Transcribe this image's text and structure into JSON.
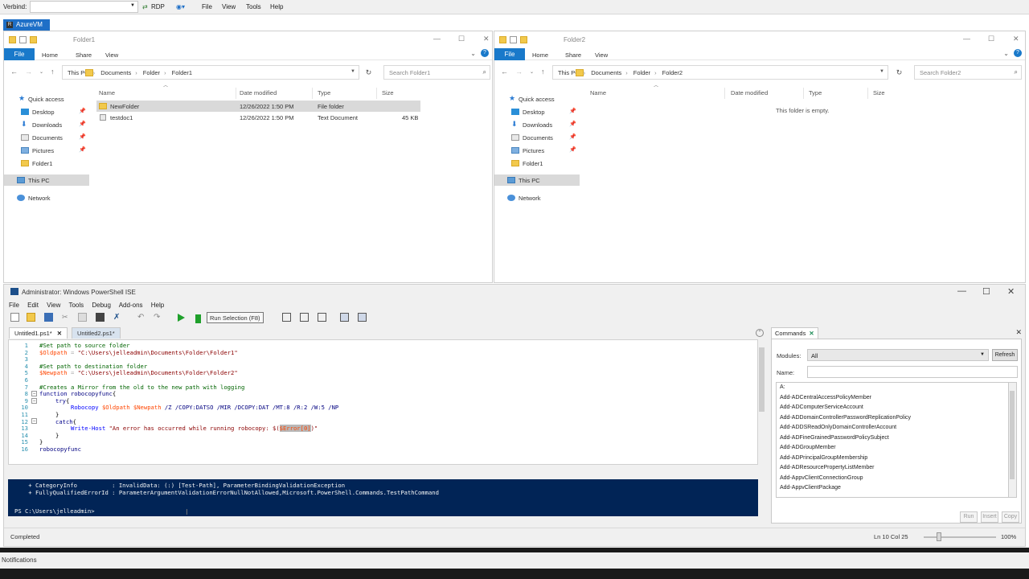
{
  "rdp": {
    "verbind_label": "Verbind:",
    "rdp_label": "RDP",
    "menu": [
      "File",
      "View",
      "Tools",
      "Help"
    ]
  },
  "vm": {
    "tab_label": "AzureVM",
    "tab_icon": "R"
  },
  "explorer1": {
    "title": "Folder1",
    "ribbon": {
      "file": "File",
      "home": "Home",
      "share": "Share",
      "view": "View"
    },
    "path": [
      "This PC",
      "Documents",
      "Folder",
      "Folder1"
    ],
    "search_placeholder": "Search Folder1",
    "nav": {
      "quick_access": "Quick access",
      "items": [
        "Desktop",
        "Downloads",
        "Documents",
        "Pictures",
        "Folder1"
      ],
      "this_pc": "This PC",
      "network": "Network"
    },
    "columns": [
      "Name",
      "Date modified",
      "Type",
      "Size"
    ],
    "files": [
      {
        "name": "NewFolder",
        "date": "12/26/2022 1:50 PM",
        "type": "File folder",
        "size": ""
      },
      {
        "name": "testdoc1",
        "date": "12/26/2022 1:50 PM",
        "type": "Text Document",
        "size": "45 KB"
      }
    ]
  },
  "explorer2": {
    "title": "Folder2",
    "ribbon": {
      "file": "File",
      "home": "Home",
      "share": "Share",
      "view": "View"
    },
    "path": [
      "This PC",
      "Documents",
      "Folder",
      "Folder2"
    ],
    "search_placeholder": "Search Folder2",
    "nav": {
      "quick_access": "Quick access",
      "items": [
        "Desktop",
        "Downloads",
        "Documents",
        "Pictures",
        "Folder1"
      ],
      "this_pc": "This PC",
      "network": "Network"
    },
    "columns": [
      "Name",
      "Date modified",
      "Type",
      "Size"
    ],
    "empty_text": "This folder is empty."
  },
  "ise": {
    "title": "Administrator: Windows PowerShell ISE",
    "menu": [
      "File",
      "Edit",
      "View",
      "Tools",
      "Debug",
      "Add-ons",
      "Help"
    ],
    "tooltip": "Run Selection (F8)",
    "tabs": [
      {
        "label": "Untitled1.ps1*"
      },
      {
        "label": "Untitled2.ps1*"
      }
    ],
    "line_numbers": [
      "1",
      "2",
      "3",
      "4",
      "5",
      "6",
      "7",
      "8",
      "9",
      "10",
      "11",
      "12",
      "13",
      "14",
      "15",
      "16"
    ],
    "code": {
      "l1": "#Set path to source folder",
      "l2_var": "$Oldpath",
      "l2_op": " = ",
      "l2_str": "\"C:\\Users\\jelleadmin\\Documents\\Folder\\Folder1\"",
      "l4": "#Set path to destination folder",
      "l5_var": "$Newpath",
      "l5_op": " = ",
      "l5_str": "\"C:\\Users\\jelleadmin\\Documents\\Folder\\Folder2\"",
      "l7": "#Creates a Mirror from the old to the new path with logging",
      "l8_kw": "function",
      "l8_name": " robocopyfunc",
      "l8_brace": "{",
      "l9_kw": "try",
      "l9_brace": "{",
      "l10_cmd": "Robocopy",
      "l10_v1": " $Oldpath",
      "l10_v2": " $Newpath",
      "l10_args": " /Z /COPY:DATSO /MIR /DCOPY:DAT /MT:8 /R:2 /W:5 /NP",
      "l11": "}",
      "l12_kw": "catch",
      "l12_brace": "{",
      "l13_cmd": "Write-Host",
      "l13_str": " \"An error has occurred while running robocopy: $(",
      "l13_hl": "$Error[0]",
      "l13_end": ")\"",
      "l14": "}",
      "l15": "}",
      "l16": "robocopyfunc"
    },
    "console": {
      "line1": "    + CategoryInfo          : InvalidData: (:) [Test-Path], ParameterBindingValidationException",
      "line2": "    + FullyQualifiedErrorId : ParameterArgumentValidationErrorNullNotAllowed,Microsoft.PowerShell.Commands.TestPathCommand",
      "prompt": "PS C:\\Users\\jelleadmin>"
    },
    "commands": {
      "tab_label": "Commands",
      "modules_label": "Modules:",
      "modules_value": "All",
      "refresh": "Refresh",
      "name_label": "Name:",
      "list": [
        "A:",
        "Add-ADCentralAccessPolicyMember",
        "Add-ADComputerServiceAccount",
        "Add-ADDomainControllerPasswordReplicationPolicy",
        "Add-ADDSReadOnlyDomainControllerAccount",
        "Add-ADFineGrainedPasswordPolicySubject",
        "Add-ADGroupMember",
        "Add-ADPrincipalGroupMembership",
        "Add-ADResourcePropertyListMember",
        "Add-AppvClientConnectionGroup",
        "Add-AppvClientPackage"
      ],
      "run": "Run",
      "insert": "Insert",
      "copy": "Copy"
    },
    "status": {
      "text": "Completed",
      "position": "Ln 10  Col 25",
      "zoom": "100%"
    }
  },
  "taskbar": {
    "notifications": "Notifications"
  }
}
